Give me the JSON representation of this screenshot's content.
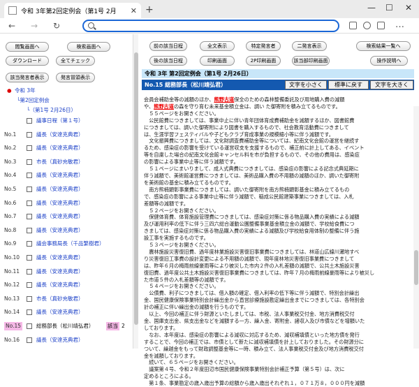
{
  "browser": {
    "tab_title": "令和 3年第2回定例会（第1号 2月",
    "address_value": "",
    "address_placeholder": ""
  },
  "left_panel": {
    "buttons": {
      "browse": "閲覧画面へ",
      "search": "検索画面へ",
      "download": "ダウンロード",
      "check_all": "全てチェック",
      "speaker_display": "該当発言者表示",
      "speaker_list": "発言冒頭表示"
    },
    "tree": {
      "year": "令和 3年",
      "session": "第2回定例会",
      "meeting": "（第1号 2月26日）",
      "items": [
        {
          "no": "",
          "label": "議事日程（第１号）"
        },
        {
          "no": "No.1",
          "label": "議長（安達克典君）"
        },
        {
          "no": "No.2",
          "label": "議長（安達克典君）"
        },
        {
          "no": "No.3",
          "label": "市長（真砂充敏君）"
        },
        {
          "no": "No.4",
          "label": "議長（安達克典君）"
        },
        {
          "no": "No.5",
          "label": "議長（安達克典君）"
        },
        {
          "no": "No.6",
          "label": "議長（安達克典君）"
        },
        {
          "no": "No.7",
          "label": "議長（安達克典君）"
        },
        {
          "no": "No.8",
          "label": "議長（安達克典君）"
        },
        {
          "no": "No.9",
          "label": "議会事務局長（千品繁樹君）"
        },
        {
          "no": "No.10",
          "label": "議長（安達克典君）"
        },
        {
          "no": "No.11",
          "label": "議長（安達克典君）"
        },
        {
          "no": "No.12",
          "label": "議長（安達克典君）"
        },
        {
          "no": "No.13",
          "label": "市長（真砂充敏君）"
        },
        {
          "no": "No.14",
          "label": "議長（安達克典君）"
        },
        {
          "no": "No.15",
          "label": "総務部長（松川靖弘君）",
          "badge": "該当",
          "badge_count": "2"
        },
        {
          "no": "No.16",
          "label": "議長（安達克典君）"
        }
      ]
    }
  },
  "right_panel": {
    "buttons": {
      "prev_item": "前の該当日程",
      "full_display": "全文表示",
      "specific_speaker": "特定発言者",
      "two_column": "二発言表示",
      "back_to_results": "検索結果一覧へ",
      "next_item": "後の該当日程",
      "print_screen": "印刷画面",
      "print_2p": "2P印刷画面",
      "print_speaker": "該当部印刷画面",
      "help": "操作説明へ"
    },
    "meeting_header": "令和 3年 第2回定例会（第1号 2月26日）",
    "speaker_bar": "No.15 総務部長（松川靖弘君）",
    "text_size": {
      "small": "文字を小さく",
      "normal": "標準に戻す",
      "large": "文字を大きく"
    },
    "highlight_term": "熊野古道",
    "body_segments": [
      {
        "t": "会員会補助金等の減額のほか、"
      },
      {
        "t": "熊野古道",
        "hl": true
      },
      {
        "t": "保全のための森林整備委託及び用地購入費の減額\nや、"
      },
      {
        "t": "熊野古道",
        "hl": true
      },
      {
        "t": "の森を守り育む未来基金積立金は、調い た御寄附を積み立てるものです。\n　５５ページをお開きください。\n　公民館費につきましては、事業中止に伴い青年団体育成費補助金を減額するほか、図書館費\nにつきましては、調いた御寄附により図書を購入するもので、社会教育活動費につきまして\nは、生涯学習フェスティバルや子どもクラブ育成事業の規模縮小等に伴う減額です。\n　文化振興費につきましては、文化財調査費補助金等については、紀南文化会館の運営を継続す\nるため、感染症の影響を受けている運営収支を支援するもので、補正前に計上してある、イベント\n等を自粛した場合の紀南文化会館キャンセル料を市が負担するもので、その他の費用は、感染症\nの影響による事業中止等に伴う減額です。\n　５１ページにまいりまして、成人式典費につきましては、感染症の影響による記念式典延期に\n伴う減額で、美術館運営費につきましては、美術品購入費の不用額の減額のほか、調いた御寄附\nを美術館の基金に積み立てるものです。\n　南方熊楠顕彰事業費につきましては、調いた御寄附を南方熊楠顕彰基金に積み立てるもの\nで、感染症の影響による事業中止等に伴う減額で、稲成公民館建築事業につきましては、入札\n差額等の減額です。\n　５２ページをお開きください。\n　保健体育費、体育施設管理費につきましては、感染症対策に係る物品購入費の実績による減額\n及び運用利率の低下に伴う三四六総合運動公園整備事業基金積立金の減額で、学校給食費につ\nきましては、感染症対策に係る物品購入費の実績による減額及び学校給食用体制の整備に伴う施\n設工事を実施するものです。\n　５３ページをお開きください。\n　農林施設災害復旧費、過年度林業施設災害復旧事業費につきましては、林道山広線川瀬地すべ\nり災害復旧工事費の設計変更による不用額の減額で、現年度林地災害復旧事業費につきまして\nは、昨年６月の梅雨前線豪雨等により被災した市内２件の入札差額の減額で、公共土木施設災害\n復旧費、過年度公共土木施設災害復旧事業費につきましては、昨年７月の梅雨前線豪雨等により被災し\nた市道５件の入札差額等の減額です。\n　５４ページをお開きください。\n　公債費、利子につきましては、借入額の確定、借入利率の低下等に伴う減額で、特別会計繰出\n金、国民健康保険事業特別会計繰出金から直営診療施設勘定繰出金までにつきましては、各特別会\n計の補正に伴い繰出金の減額を行うものです。\n　以上、今回の補正に伴う財源といたしましては、市税、法人事業税交付金、地方消費税交付\n金、国庫支出金、県支出金などを減額する一方、繰入金、寄附金、諸収入及び市債などを増額いた\nしております。\n　なお、本年度は、感染症の影響による減収に対応するため、減収補填債といった地方債を発行\nすることで、今回の補正では、市債として新たに減収補填債を計上しておりました。その財源分に\nついて、繰越金をもって財政調整基金等に一時、積み立て、法人事業税交付金及び地方消費税交付\n金を減額しております。\n　続いて、６５ページをお開きください。\n　議案第４号、令和２年度田辺市国民健康保険事業特別会計補正予算（第５号）は、次に\n定めるところによる。\n　第１条、事業勘定の歳入歳出予算の総額から歳入歳出それぞれ１，０７１万８，０００円を減額"
      }
    ]
  }
}
